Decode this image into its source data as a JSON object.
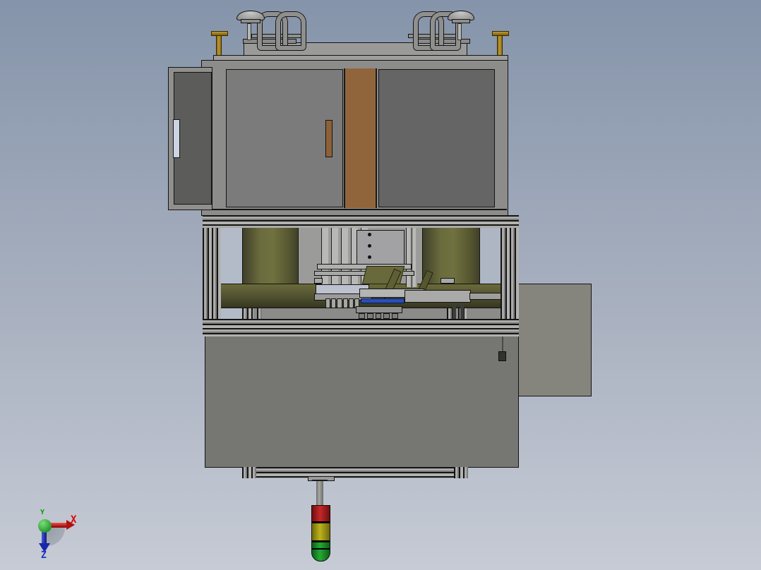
{
  "viewport": {
    "type": "cad-3d-orthographic-view",
    "description": "Front view of an automated assembly machine: upper electrical cabinet with doors, cable drag chains and lifting eyebolts on top, mid frame with two olive drums and rotary indexing mechanism, lower base cabinet with side table and downward signal tower light"
  },
  "triad": {
    "x_label": "X",
    "y_label": "Y",
    "z_label": "Z"
  },
  "colors": {
    "bg_top": "#8594aa",
    "bg_bottom": "#c6cbd5",
    "metal": "#8c8c8a",
    "door_left": "#7b7b7b",
    "door_right": "#656565",
    "side_door": "#5c5c5a",
    "brown": "#91653b",
    "handle_brown": "#8d6138",
    "slot_light": "#ccd4e2",
    "olive": "#5f6036",
    "olive_dark": "#3f402a",
    "band_top": "#6a6b3a",
    "band_bottom": "#35361f",
    "lower": "#767672",
    "panel": "#85857d",
    "backdrop": "#9b9b99",
    "light_patch": "#b4bbc8",
    "gold": "#a07b1d",
    "blue": "#2a4fbb",
    "tower_red": "#c62828",
    "tower_yellow": "#bdb31c",
    "tower_green": "#27a835",
    "axis_x": "#e00000",
    "axis_y": "#00a000",
    "axis_z": "#2030c0"
  }
}
